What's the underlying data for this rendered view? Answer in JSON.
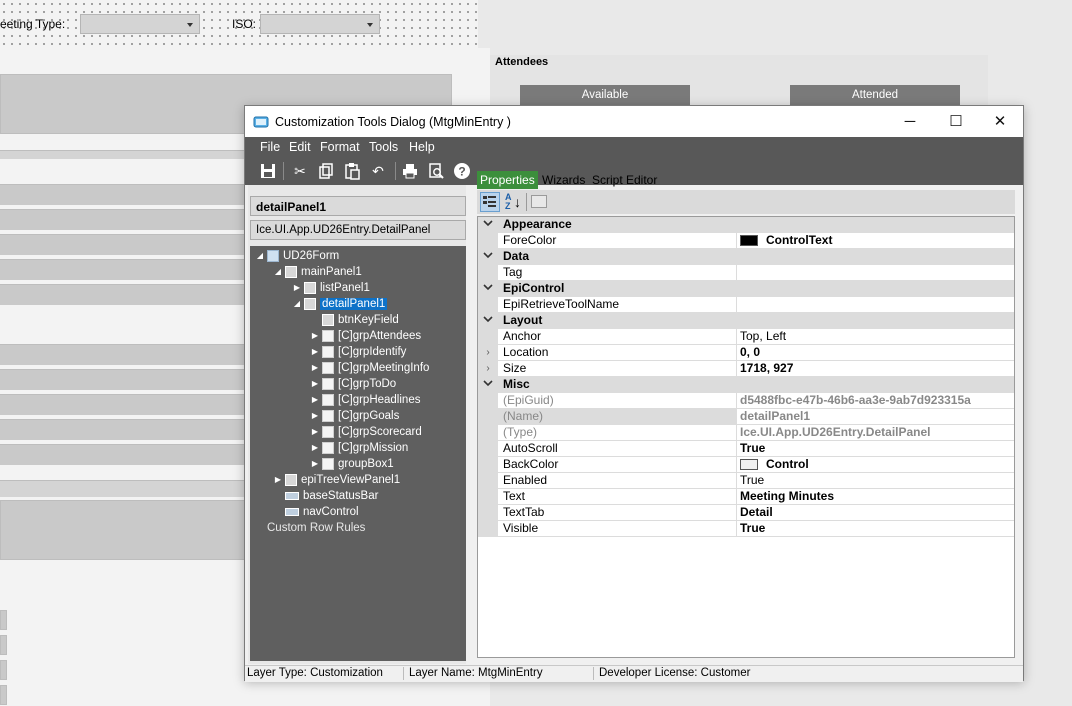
{
  "background_form": {
    "meeting_type_label": "eeting Type:",
    "iso_label": "ISO:",
    "attendees_title": "Attendees",
    "available_header": "Available",
    "attended_header": "Attended"
  },
  "dialog": {
    "title": "Customization Tools Dialog  (MtgMinEntry )",
    "minimize": "─",
    "maximize": "☐",
    "close": "✕"
  },
  "menu": [
    "File",
    "Edit",
    "Format",
    "Tools",
    "Help"
  ],
  "toolbar_icons": [
    "save-icon",
    "cut-icon",
    "copy-icon",
    "paste-icon",
    "undo-icon",
    "print-icon",
    "print-preview-icon",
    "help-icon"
  ],
  "left": {
    "selected_name": "detailPanel1",
    "selected_type": "Ice.UI.App.UD26Entry.DetailPanel"
  },
  "tree": [
    {
      "label": "UD26Form",
      "toggle": "◢",
      "icon": "form"
    },
    {
      "label": "mainPanel1",
      "toggle": "◢",
      "icon": "panel"
    },
    {
      "label": "listPanel1",
      "toggle": "▶",
      "icon": "panel"
    },
    {
      "label": "detailPanel1",
      "toggle": "◢",
      "icon": "panel"
    },
    {
      "label": "btnKeyField",
      "toggle": "",
      "icon": "button"
    },
    {
      "label": "[C]grpAttendees",
      "toggle": "▶",
      "icon": "folder"
    },
    {
      "label": "[C]grpIdentify",
      "toggle": "▶",
      "icon": "folder"
    },
    {
      "label": "[C]grpMeetingInfo",
      "toggle": "▶",
      "icon": "folder"
    },
    {
      "label": "[C]grpToDo",
      "toggle": "▶",
      "icon": "folder"
    },
    {
      "label": "[C]grpHeadlines",
      "toggle": "▶",
      "icon": "folder"
    },
    {
      "label": "[C]grpGoals",
      "toggle": "▶",
      "icon": "folder"
    },
    {
      "label": "[C]grpScorecard",
      "toggle": "▶",
      "icon": "folder"
    },
    {
      "label": "[C]grpMission",
      "toggle": "▶",
      "icon": "folder"
    },
    {
      "label": "groupBox1",
      "toggle": "▶",
      "icon": "folder"
    },
    {
      "label": "epiTreeViewPanel1",
      "toggle": "▶",
      "icon": "panel"
    },
    {
      "label": "baseStatusBar",
      "toggle": "",
      "icon": "statusbar"
    },
    {
      "label": "navControl",
      "toggle": "",
      "icon": "nav"
    },
    {
      "label": "Custom Row Rules",
      "toggle": "",
      "icon": ""
    }
  ],
  "tabs": [
    "Properties",
    "Wizards",
    "Script Editor"
  ],
  "props": [
    {
      "kind": "cat",
      "label": "Appearance"
    },
    {
      "kind": "prop",
      "name": "ForeColor",
      "value": "ControlText",
      "style": "bold",
      "swatch": "#000000"
    },
    {
      "kind": "cat",
      "label": "Data"
    },
    {
      "kind": "prop",
      "name": "Tag",
      "value": ""
    },
    {
      "kind": "cat",
      "label": "EpiControl"
    },
    {
      "kind": "prop",
      "name": "EpiRetrieveToolName",
      "value": ""
    },
    {
      "kind": "cat",
      "label": "Layout"
    },
    {
      "kind": "prop",
      "name": "Anchor",
      "value": "Top, Left"
    },
    {
      "kind": "prop",
      "name": "Location",
      "value": "0, 0",
      "style": "bold",
      "expand": "›"
    },
    {
      "kind": "prop",
      "name": "Size",
      "value": "1718, 927",
      "style": "bold",
      "expand": "›"
    },
    {
      "kind": "cat",
      "label": "Misc"
    },
    {
      "kind": "prop",
      "name": "(EpiGuid)",
      "value": "d5488fbc-e47b-46b6-aa3e-9ab7d923315a",
      "style": "dimbold",
      "dimname": true
    },
    {
      "kind": "prop",
      "name": "(Name)",
      "value": "detailPanel1",
      "style": "dimbold",
      "dimname": true,
      "selected": true
    },
    {
      "kind": "prop",
      "name": "(Type)",
      "value": "Ice.UI.App.UD26Entry.DetailPanel",
      "style": "dimbold",
      "dimname": true
    },
    {
      "kind": "prop",
      "name": "AutoScroll",
      "value": "True",
      "style": "bold"
    },
    {
      "kind": "prop",
      "name": "BackColor",
      "value": "Control",
      "style": "bold",
      "swatch": "#f0f0f0"
    },
    {
      "kind": "prop",
      "name": "Enabled",
      "value": "True"
    },
    {
      "kind": "prop",
      "name": "Text",
      "value": "Meeting Minutes",
      "style": "bold"
    },
    {
      "kind": "prop",
      "name": "TextTab",
      "value": "Detail",
      "style": "bold"
    },
    {
      "kind": "prop",
      "name": "Visible",
      "value": "True",
      "style": "bold"
    }
  ],
  "status": {
    "layer_type": "Layer Type:  Customization",
    "layer_name": "Layer Name:  MtgMinEntry",
    "license": "Developer License:  Customer"
  },
  "colors": {
    "accent_tab": "#3c8f3c",
    "selection": "#0e72c8",
    "chrome_dark": "#585858",
    "tree_bg": "#5f5f5f"
  }
}
